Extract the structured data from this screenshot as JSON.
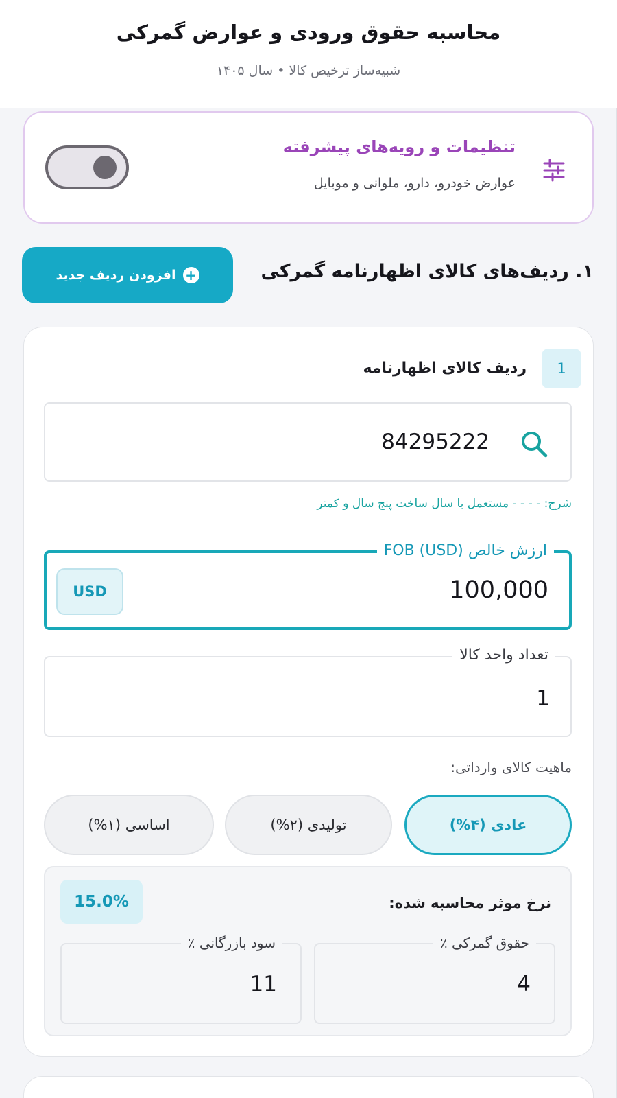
{
  "header": {
    "title": "محاسبه حقوق ورودی و عوارض گمرکی",
    "subtitle": "شبیه‌ساز ترخیص کالا • سال ۱۴۰۵"
  },
  "advanced": {
    "title": "تنظیمات و رویه‌های پیشرفته",
    "subtitle": "عوارض خودرو، دارو، ملوانی و موبایل",
    "icon": "sliders-icon",
    "toggle_on": false,
    "accent": "#9a45b8"
  },
  "section": {
    "title": "۱. ردیف‌های کالای اظهارنامه گمرکی",
    "add_button": "افزودن ردیف جدید",
    "add_icon": "plus-circle-icon"
  },
  "item": {
    "number": "1",
    "title": "ردیف کالای اظهارنامه",
    "hs_code": "84295222",
    "description": "شرح: - - - - مستعمل با سال ساخت پنج سال و کمتر",
    "fob_label": "ارزش خالص FOB (USD)",
    "fob_value": "100,000",
    "currency": "USD",
    "qty_label": "تعداد واحد کالا",
    "qty_value": "1",
    "nature_label": "ماهیت کالای وارداتی:",
    "nature_options": [
      "عادی (۴%)",
      "تولیدی (۲%)",
      "اساسی (۱%)"
    ],
    "nature_selected": "عادی (۴%)",
    "effective_rate_label": "نرخ موثر محاسبه شده:",
    "effective_rate": "15.0%",
    "duty_label": "حقوق گمرکی ٪",
    "duty_value": "4",
    "profit_label": "سود بازرگانی ٪",
    "profit_value": "11"
  },
  "colors": {
    "primary": "#16a9c6",
    "teal_text": "#18a3a0",
    "purple": "#9a45b8"
  }
}
